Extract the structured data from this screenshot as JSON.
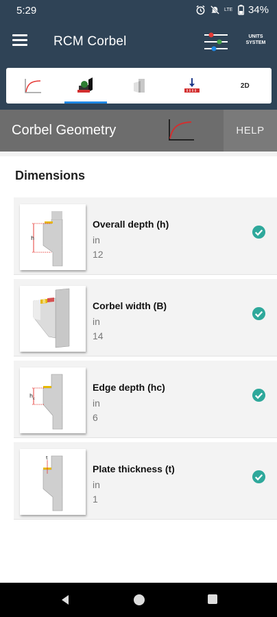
{
  "status_bar": {
    "time": "5:29",
    "battery_percent": "34%",
    "network_label": "LTE"
  },
  "app_bar": {
    "title": "RCM Corbel",
    "units_button_line1": "UNITS",
    "units_button_line2": "SYSTEM"
  },
  "tabs": [
    {
      "name": "curve",
      "icon": "stress-strain-curve-icon"
    },
    {
      "name": "loads",
      "icon": "corbel-load-icon",
      "active": true
    },
    {
      "name": "geometry",
      "icon": "corbel-3d-icon"
    },
    {
      "name": "bearing",
      "icon": "bearing-load-icon"
    },
    {
      "name": "2d",
      "label": "2D"
    }
  ],
  "section": {
    "title": "Corbel Geometry",
    "help_label": "HELP"
  },
  "dimensions": {
    "heading": "Dimensions",
    "items": [
      {
        "label": "Overall depth (h)",
        "unit": "in",
        "value": "12",
        "diagram": "h",
        "valid": true
      },
      {
        "label": "Corbel width (B)",
        "unit": "in",
        "value": "14",
        "diagram": "B",
        "valid": true
      },
      {
        "label": "Edge depth (hc)",
        "unit": "in",
        "value": "6",
        "diagram": "hc",
        "valid": true
      },
      {
        "label": "Plate thickness (t)",
        "unit": "in",
        "value": "1",
        "diagram": "t",
        "valid": true
      }
    ]
  },
  "colors": {
    "app_bar": "#2f4356",
    "section_header": "#6d6d6d",
    "check": "#2ea89b",
    "tab_indicator": "#1e88e5"
  }
}
